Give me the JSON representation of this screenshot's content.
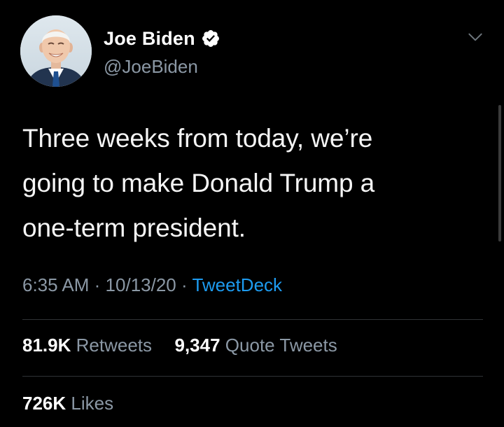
{
  "tweet": {
    "author": {
      "name": "Joe Biden",
      "handle": "@JoeBiden",
      "verified": true
    },
    "text_lines": [
      "Three weeks from today, we’re",
      "going to make Donald Trump a",
      "one-term president."
    ],
    "time": "6:35 AM",
    "separator": "·",
    "date": "10/13/20",
    "source": "TweetDeck",
    "retweets": {
      "count": "81.9K",
      "label": "Retweets"
    },
    "quote_tweets": {
      "count": "9,347",
      "label": "Quote Tweets"
    },
    "likes": {
      "count": "726K",
      "label": "Likes"
    }
  },
  "colors": {
    "background": "#000000",
    "text": "#f5f5f5",
    "secondary": "#8b98a5",
    "link": "#1d9bf0",
    "divider": "#2f3336"
  },
  "icons": {
    "avatar": "avatar-photo",
    "verified": "verified-badge-icon",
    "menu": "chevron-down-icon"
  }
}
